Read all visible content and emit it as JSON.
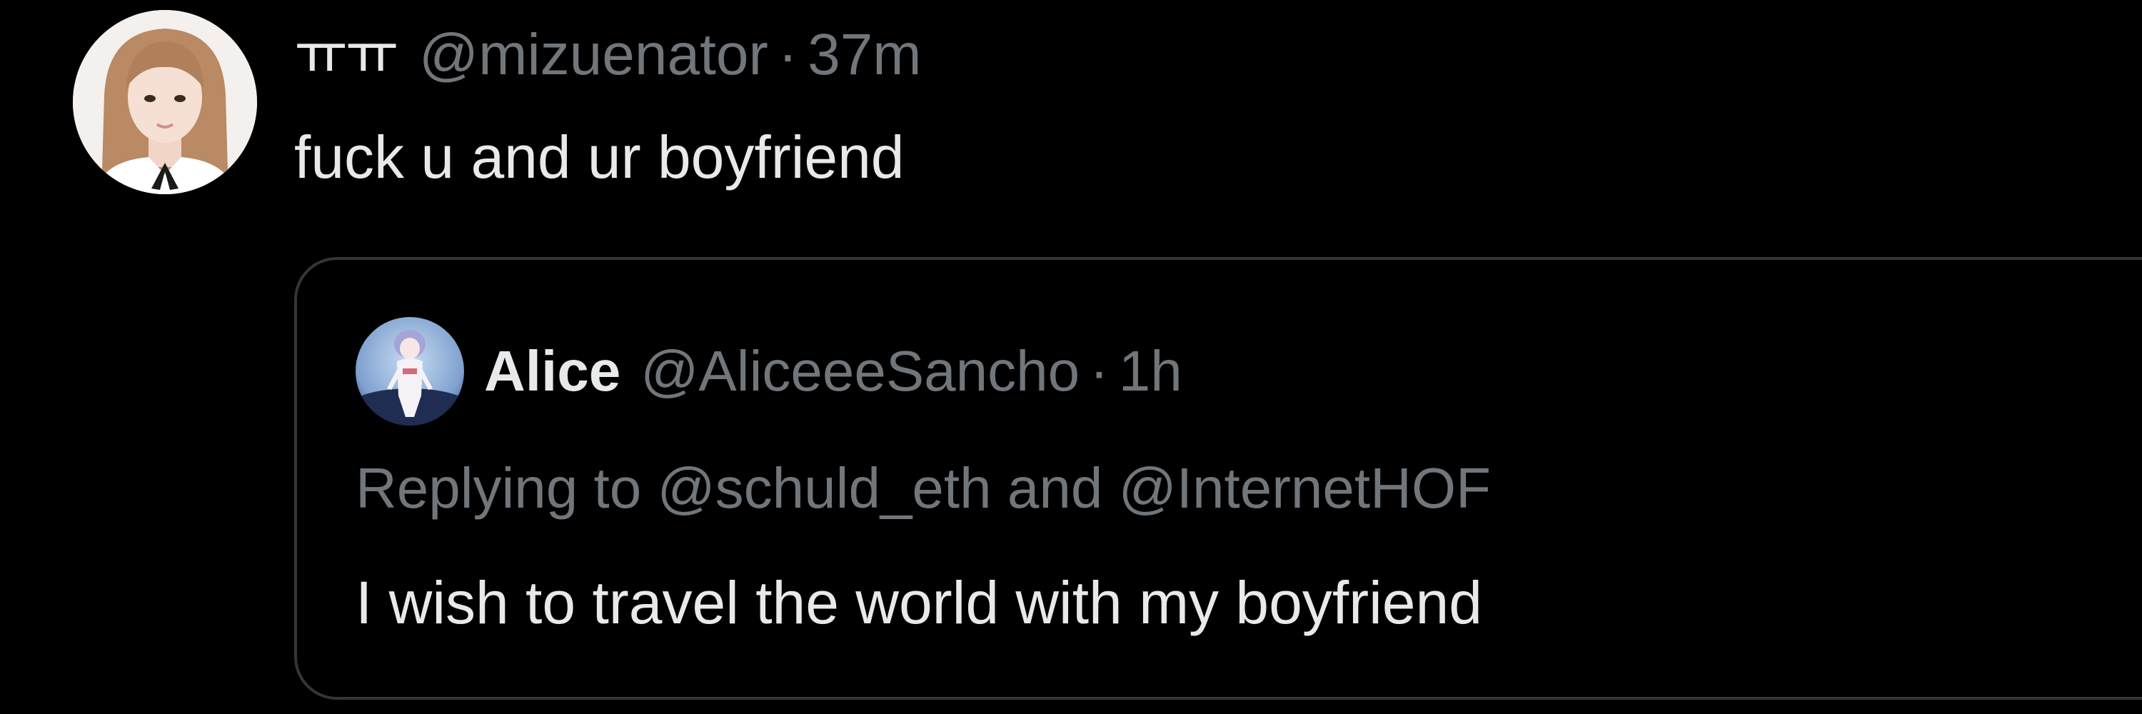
{
  "tweet": {
    "display_name": "ㅠㅠ",
    "handle": "@mizuenator",
    "separator": "·",
    "time": "37m",
    "text": "fuck u and ur boyfriend",
    "avatar_icon": "profile-photo-girl"
  },
  "quote": {
    "display_name": "Alice",
    "handle": "@AliceeeSancho",
    "separator": "·",
    "time": "1h",
    "replying_prefix": "Replying to",
    "replying_user_1": "@schuld_eth",
    "replying_and": "and",
    "replying_user_2": "@InternetHOF",
    "text": "I wish to travel the world with my boyfriend",
    "avatar_icon": "anime-character-avatar"
  },
  "colors": {
    "background": "#000000",
    "text_primary": "#e7e9ea",
    "text_secondary": "#71767b",
    "border": "#333639"
  }
}
